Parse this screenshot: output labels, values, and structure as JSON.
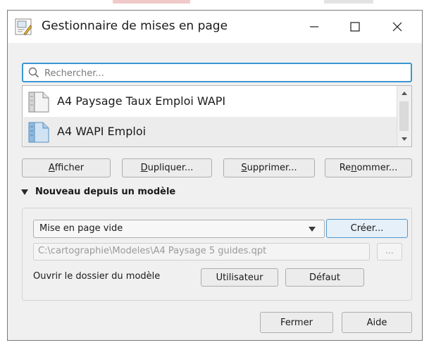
{
  "window": {
    "title": "Gestionnaire de mises en page",
    "icon": "layout-manager-icon",
    "controls": [
      "minimize-icon",
      "maximize-icon",
      "close-icon"
    ]
  },
  "search": {
    "placeholder": "Rechercher...",
    "value": ""
  },
  "layouts": [
    {
      "label": "A4 Paysage Taux Emploi WAPI",
      "icon": "layout-document-icon",
      "selected": false
    },
    {
      "label": "A4 WAPI Emploi",
      "icon": "layout-document-icon",
      "selected": true
    }
  ],
  "actions": {
    "show": {
      "label": "Afficher",
      "mnemonic": "A"
    },
    "duplicate": {
      "label": "Dupliquer...",
      "mnemonic": "D"
    },
    "delete": {
      "label": "Supprimer...",
      "mnemonic": "S"
    },
    "rename": {
      "label": "Renommer...",
      "mnemonic": "n"
    }
  },
  "new_from_template": {
    "heading": "Nouveau depuis un modèle",
    "expanded": true,
    "template_select": {
      "value": "Mise en page vide"
    },
    "create_label": "Créer...",
    "path_value": "C:\\cartographie\\Modeles\\A4 Paysage 5 guides.qpt",
    "browse_label": "...",
    "open_folder_label": "Ouvrir le dossier du modèle",
    "user_label": "Utilisateur",
    "default_label": "Défaut"
  },
  "footer": {
    "close_label": "Fermer",
    "help_label": "Aide"
  },
  "colors": {
    "focus_accent": "#3b97d3",
    "selected_row": "#ececec",
    "dialog_bg": "#f0f0f0"
  }
}
